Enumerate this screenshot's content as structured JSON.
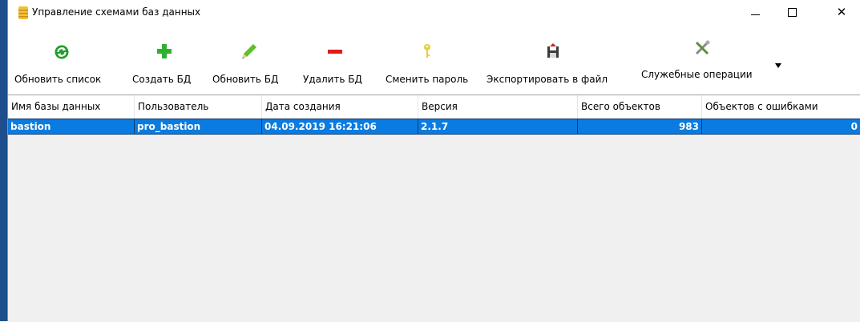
{
  "window": {
    "title": "Управление схемами баз данных",
    "icon": "database-icon",
    "controls": {
      "minimize": "minimize-icon",
      "maximize": "maximize-icon",
      "close": "close-icon",
      "close_glyph": "✕"
    }
  },
  "toolbar": {
    "refresh": {
      "label": "Обновить список",
      "icon": "refresh-icon"
    },
    "create": {
      "label": "Создать БД",
      "icon": "plus-icon"
    },
    "update": {
      "label": "Обновить БД",
      "icon": "pencil-icon"
    },
    "delete": {
      "label": "Удалить БД",
      "icon": "minus-icon"
    },
    "change_password": {
      "label": "Сменить пароль",
      "icon": "key-icon"
    },
    "export": {
      "label": "Экспортировать в файл",
      "icon": "save-icon"
    },
    "service": {
      "label": "Служебные операции",
      "icon": "tools-icon"
    },
    "overflow_glyph": "▼"
  },
  "grid": {
    "columns": [
      "Имя базы данных",
      "Пользователь",
      "Дата создания",
      "Версия",
      "Всего объектов",
      "Объектов с ошибками"
    ],
    "rows": [
      [
        "bastion",
        "pro_bastion",
        "04.09.2019 16:21:06",
        "2.1.7",
        "983",
        "0"
      ]
    ],
    "selection_color": "#0a7be0"
  }
}
